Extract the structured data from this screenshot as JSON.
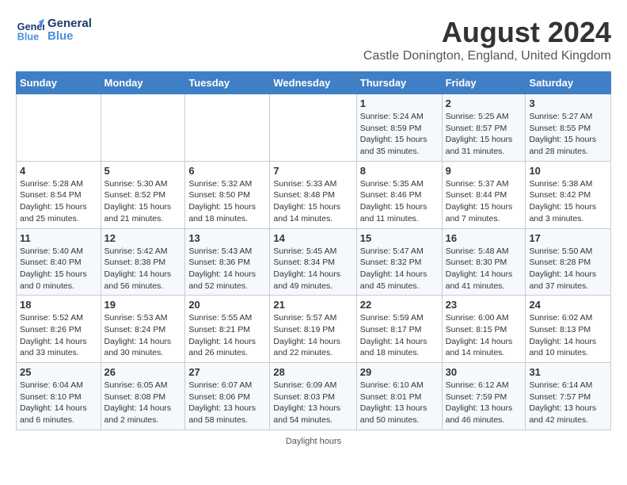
{
  "header": {
    "logo_line1": "General",
    "logo_line2": "Blue",
    "month": "August 2024",
    "location": "Castle Donington, England, United Kingdom"
  },
  "days_of_week": [
    "Sunday",
    "Monday",
    "Tuesday",
    "Wednesday",
    "Thursday",
    "Friday",
    "Saturday"
  ],
  "weeks": [
    [
      {
        "day": "",
        "info": ""
      },
      {
        "day": "",
        "info": ""
      },
      {
        "day": "",
        "info": ""
      },
      {
        "day": "",
        "info": ""
      },
      {
        "day": "1",
        "info": "Sunrise: 5:24 AM\nSunset: 8:59 PM\nDaylight: 15 hours and 35 minutes."
      },
      {
        "day": "2",
        "info": "Sunrise: 5:25 AM\nSunset: 8:57 PM\nDaylight: 15 hours and 31 minutes."
      },
      {
        "day": "3",
        "info": "Sunrise: 5:27 AM\nSunset: 8:55 PM\nDaylight: 15 hours and 28 minutes."
      }
    ],
    [
      {
        "day": "4",
        "info": "Sunrise: 5:28 AM\nSunset: 8:54 PM\nDaylight: 15 hours and 25 minutes."
      },
      {
        "day": "5",
        "info": "Sunrise: 5:30 AM\nSunset: 8:52 PM\nDaylight: 15 hours and 21 minutes."
      },
      {
        "day": "6",
        "info": "Sunrise: 5:32 AM\nSunset: 8:50 PM\nDaylight: 15 hours and 18 minutes."
      },
      {
        "day": "7",
        "info": "Sunrise: 5:33 AM\nSunset: 8:48 PM\nDaylight: 15 hours and 14 minutes."
      },
      {
        "day": "8",
        "info": "Sunrise: 5:35 AM\nSunset: 8:46 PM\nDaylight: 15 hours and 11 minutes."
      },
      {
        "day": "9",
        "info": "Sunrise: 5:37 AM\nSunset: 8:44 PM\nDaylight: 15 hours and 7 minutes."
      },
      {
        "day": "10",
        "info": "Sunrise: 5:38 AM\nSunset: 8:42 PM\nDaylight: 15 hours and 3 minutes."
      }
    ],
    [
      {
        "day": "11",
        "info": "Sunrise: 5:40 AM\nSunset: 8:40 PM\nDaylight: 15 hours and 0 minutes."
      },
      {
        "day": "12",
        "info": "Sunrise: 5:42 AM\nSunset: 8:38 PM\nDaylight: 14 hours and 56 minutes."
      },
      {
        "day": "13",
        "info": "Sunrise: 5:43 AM\nSunset: 8:36 PM\nDaylight: 14 hours and 52 minutes."
      },
      {
        "day": "14",
        "info": "Sunrise: 5:45 AM\nSunset: 8:34 PM\nDaylight: 14 hours and 49 minutes."
      },
      {
        "day": "15",
        "info": "Sunrise: 5:47 AM\nSunset: 8:32 PM\nDaylight: 14 hours and 45 minutes."
      },
      {
        "day": "16",
        "info": "Sunrise: 5:48 AM\nSunset: 8:30 PM\nDaylight: 14 hours and 41 minutes."
      },
      {
        "day": "17",
        "info": "Sunrise: 5:50 AM\nSunset: 8:28 PM\nDaylight: 14 hours and 37 minutes."
      }
    ],
    [
      {
        "day": "18",
        "info": "Sunrise: 5:52 AM\nSunset: 8:26 PM\nDaylight: 14 hours and 33 minutes."
      },
      {
        "day": "19",
        "info": "Sunrise: 5:53 AM\nSunset: 8:24 PM\nDaylight: 14 hours and 30 minutes."
      },
      {
        "day": "20",
        "info": "Sunrise: 5:55 AM\nSunset: 8:21 PM\nDaylight: 14 hours and 26 minutes."
      },
      {
        "day": "21",
        "info": "Sunrise: 5:57 AM\nSunset: 8:19 PM\nDaylight: 14 hours and 22 minutes."
      },
      {
        "day": "22",
        "info": "Sunrise: 5:59 AM\nSunset: 8:17 PM\nDaylight: 14 hours and 18 minutes."
      },
      {
        "day": "23",
        "info": "Sunrise: 6:00 AM\nSunset: 8:15 PM\nDaylight: 14 hours and 14 minutes."
      },
      {
        "day": "24",
        "info": "Sunrise: 6:02 AM\nSunset: 8:13 PM\nDaylight: 14 hours and 10 minutes."
      }
    ],
    [
      {
        "day": "25",
        "info": "Sunrise: 6:04 AM\nSunset: 8:10 PM\nDaylight: 14 hours and 6 minutes."
      },
      {
        "day": "26",
        "info": "Sunrise: 6:05 AM\nSunset: 8:08 PM\nDaylight: 14 hours and 2 minutes."
      },
      {
        "day": "27",
        "info": "Sunrise: 6:07 AM\nSunset: 8:06 PM\nDaylight: 13 hours and 58 minutes."
      },
      {
        "day": "28",
        "info": "Sunrise: 6:09 AM\nSunset: 8:03 PM\nDaylight: 13 hours and 54 minutes."
      },
      {
        "day": "29",
        "info": "Sunrise: 6:10 AM\nSunset: 8:01 PM\nDaylight: 13 hours and 50 minutes."
      },
      {
        "day": "30",
        "info": "Sunrise: 6:12 AM\nSunset: 7:59 PM\nDaylight: 13 hours and 46 minutes."
      },
      {
        "day": "31",
        "info": "Sunrise: 6:14 AM\nSunset: 7:57 PM\nDaylight: 13 hours and 42 minutes."
      }
    ]
  ],
  "footer": {
    "daylight_label": "Daylight hours"
  }
}
